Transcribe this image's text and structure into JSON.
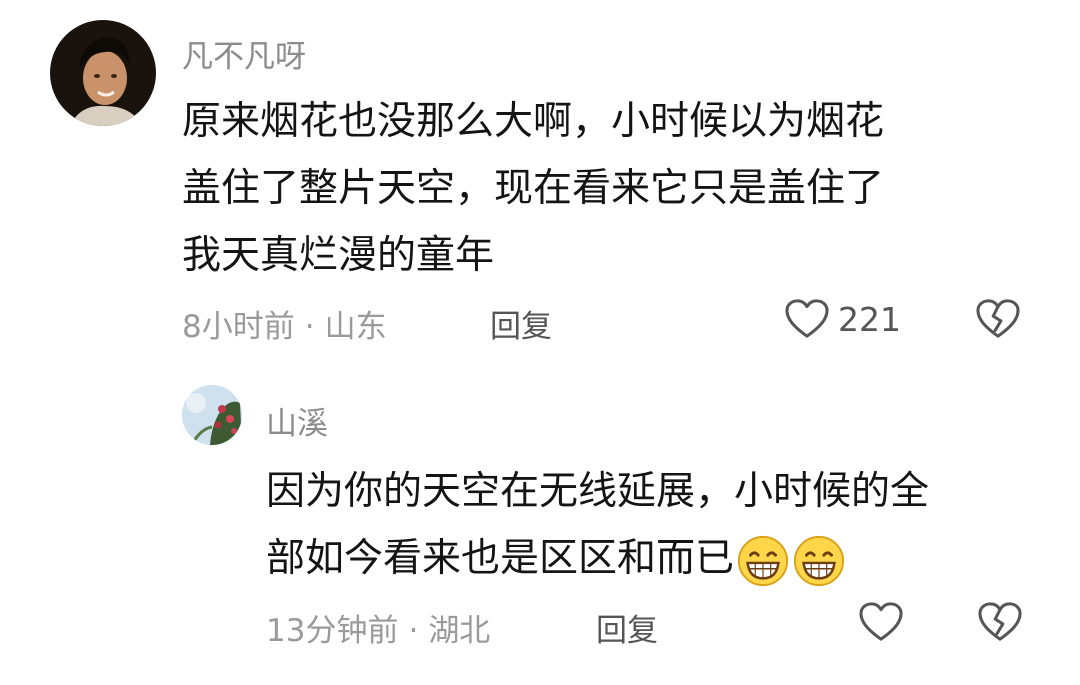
{
  "comments": [
    {
      "username": "凡不凡呀",
      "content_lines": [
        "原来烟花也没那么大啊，小时候以为烟花",
        "盖住了整片天空，现在看来它只是盖住了",
        "我天真烂漫的童年"
      ],
      "time": "8小时前",
      "separator": "·",
      "location": "山东",
      "reply_label": "回复",
      "like_count": "221",
      "icons": {
        "like": "heart-outline-icon",
        "dislike": "broken-heart-icon"
      }
    },
    {
      "username": "山溪",
      "content_lines": [
        "因为你的天空在无线延展，小时候的全",
        "部如今看来也是区区和而已"
      ],
      "emojis": [
        "grinning-face-emoji",
        "grinning-face-emoji"
      ],
      "time": "13分钟前",
      "separator": "·",
      "location": "湖北",
      "reply_label": "回复",
      "icons": {
        "like": "heart-outline-icon",
        "dislike": "broken-heart-icon"
      }
    }
  ],
  "colors": {
    "username": "#8c8c8c",
    "text": "#141414",
    "meta": "#9a9a9a",
    "icon": "#555555"
  }
}
